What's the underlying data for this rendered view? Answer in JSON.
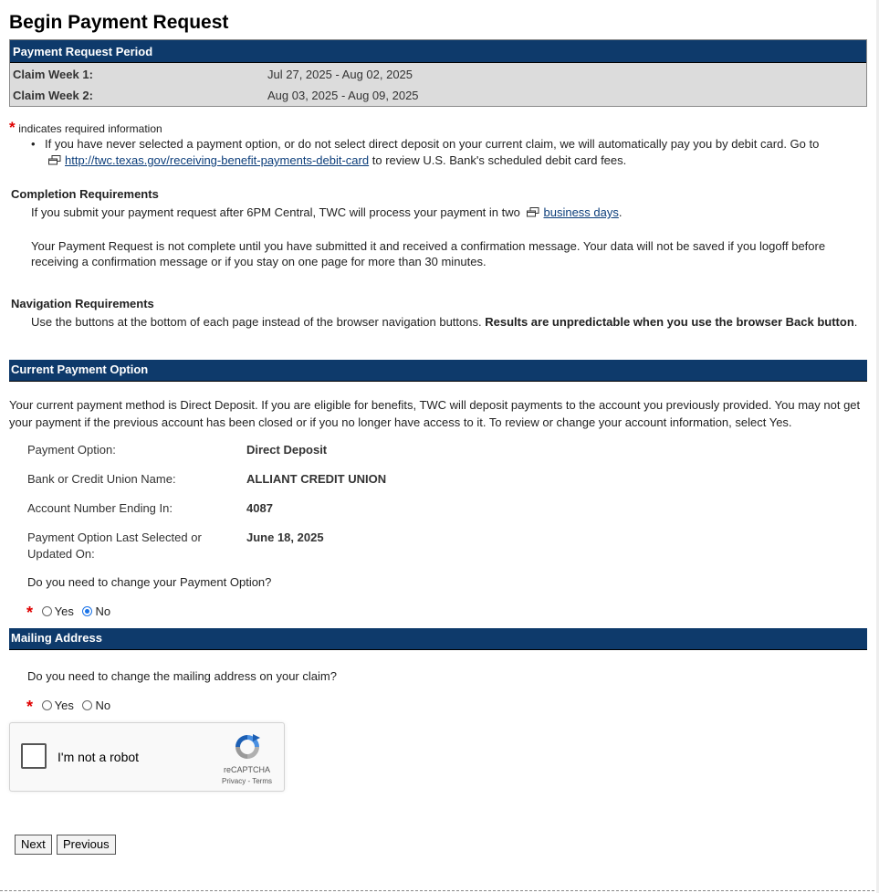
{
  "page": {
    "title": "Begin Payment Request"
  },
  "period": {
    "heading": "Payment Request Period",
    "weeks": [
      {
        "label": "Claim Week 1:",
        "value": "Jul 27, 2025 - Aug 02, 2025"
      },
      {
        "label": "Claim Week 2:",
        "value": "Aug 03, 2025 - Aug 09, 2025"
      }
    ]
  },
  "required_note": {
    "star": "*",
    "text": "indicates required information"
  },
  "debit_notice": {
    "text_before": "If you have never selected a payment option, or do not select direct deposit on your current claim, we will automatically pay you by debit card. Go to",
    "link": "http://twc.texas.gov/receiving-benefit-payments-debit-card",
    "text_after": "to review U.S. Bank's scheduled debit card fees."
  },
  "completion": {
    "heading": "Completion Requirements",
    "line1_before": "If you submit your payment request after 6PM Central, TWC will process your payment in two",
    "line1_link": "business days",
    "line1_after": ".",
    "para2": "Your Payment Request is not complete until you have submitted it and received a confirmation message. Your data will not be saved if you logoff before receiving a confirmation message or if you stay on one page for more than 30 minutes."
  },
  "navigation": {
    "heading": "Navigation Requirements",
    "text_before": "Use the buttons at the bottom of each page instead of the browser navigation buttons.",
    "text_bold": "Results are unpredictable when you use the browser Back button",
    "text_after": "."
  },
  "current_payment": {
    "heading": "Current Payment Option",
    "description": "Your current payment method is Direct Deposit. If you are eligible for benefits, TWC will deposit payments to the account you previously provided. You may not get your payment if the previous account has been closed or if you no longer have access to it. To review or change your account information, select Yes.",
    "fields": [
      {
        "label": "Payment Option:",
        "value": "Direct Deposit"
      },
      {
        "label": "Bank or Credit Union Name:",
        "value": "ALLIANT CREDIT UNION"
      },
      {
        "label": "Account Number Ending In:",
        "value": "4087"
      },
      {
        "label": "Payment Option Last Selected or Updated On:",
        "value": "June 18, 2025"
      }
    ],
    "question": "Do you need to change your Payment Option?",
    "yes_label": "Yes",
    "no_label": "No",
    "selected": "No"
  },
  "mailing": {
    "heading": "Mailing Address",
    "question": "Do you need to change the mailing address on your claim?",
    "yes_label": "Yes",
    "no_label": "No",
    "selected": ""
  },
  "captcha": {
    "label": "I'm not a robot",
    "brand": "reCAPTCHA",
    "privacy": "Privacy",
    "separator": " - ",
    "terms": "Terms",
    "checked": false
  },
  "buttons": {
    "next": "Next",
    "previous": "Previous"
  },
  "colors": {
    "section_bar": "#0e3a6b",
    "period_bg": "#dcdcdc",
    "required_star": "#e00000",
    "link": "#0b3d7a"
  }
}
